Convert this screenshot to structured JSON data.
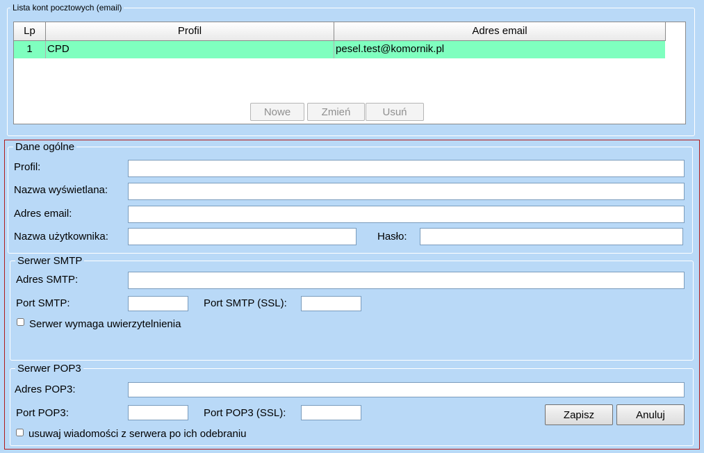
{
  "accounts_section": {
    "legend": "Lista kont pocztowych (email)",
    "columns": [
      "Lp",
      "Profil",
      "Adres email"
    ],
    "rows": [
      {
        "lp": "1",
        "profil": "CPD",
        "email": "pesel.test@komornik.pl"
      }
    ],
    "buttons": {
      "new": "Nowe",
      "edit": "Zmień",
      "delete": "Usuń"
    }
  },
  "general": {
    "legend": "Dane ogólne",
    "profile_label": "Profil:",
    "display_name_label": "Nazwa wyświetlana:",
    "email_label": "Adres email:",
    "username_label": "Nazwa użytkownika:",
    "password_label": "Hasło:",
    "profile_value": "",
    "display_name_value": "",
    "email_value": "",
    "username_value": "",
    "password_value": ""
  },
  "smtp": {
    "legend": "Serwer SMTP",
    "address_label": "Adres SMTP:",
    "port_label": "Port SMTP:",
    "port_ssl_label": "Port SMTP (SSL):",
    "auth_label": "Serwer wymaga uwierzytelnienia",
    "address_value": "",
    "port_value": "",
    "port_ssl_value": ""
  },
  "pop3": {
    "legend": "Serwer POP3",
    "address_label": "Adres POP3:",
    "port_label": "Port POP3:",
    "port_ssl_label": "Port POP3 (SSL):",
    "delete_label": "usuwaj wiadomości z serwera po ich odebraniu",
    "address_value": "",
    "port_value": "",
    "port_ssl_value": ""
  },
  "actions": {
    "save": "Zapisz",
    "cancel": "Anuluj"
  },
  "colors": {
    "background": "#b9d9f7",
    "selected_row": "#7fffbf",
    "highlight_border": "#b01818"
  }
}
